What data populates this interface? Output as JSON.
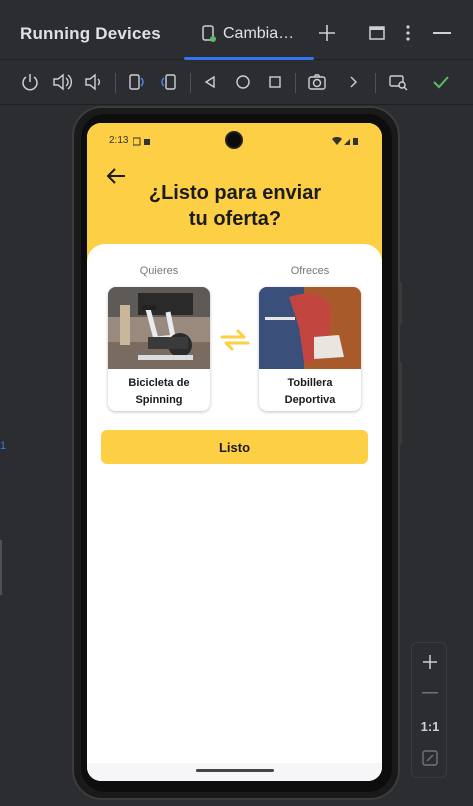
{
  "window": {
    "title": "Running Devices",
    "tab_label": "Cambia…",
    "tab_actions": [
      "add-icon",
      "window-icon",
      "more-vertical-icon",
      "minimize-icon"
    ]
  },
  "toolbar": {
    "buttons": [
      "power-icon",
      "volume-up-icon",
      "volume-down-icon",
      "rotate-left-icon",
      "rotate-right-icon",
      "back-icon",
      "home-icon",
      "overview-icon",
      "camera-icon",
      "chevron-right-icon",
      "device-mirror-icon",
      "check-icon"
    ]
  },
  "device": {
    "status": {
      "time": "2:13"
    },
    "header": {
      "title_line1": "¿Listo para enviar",
      "title_line2": "tu oferta?"
    },
    "trade": {
      "want_label": "Quieres",
      "offer_label": "Ofreces",
      "want_item": "Bicicleta de Spinning",
      "offer_item": "Tobillera Deportiva"
    },
    "cta_label": "Listo"
  },
  "zoom": {
    "zoom_in": "+",
    "zoom_out": "−",
    "actual_size": "1:1"
  },
  "colors": {
    "accent": "#fdcf45",
    "ide_bg": "#2b2d30",
    "tab_underline": "#3574f0",
    "check": "#5fb865"
  }
}
